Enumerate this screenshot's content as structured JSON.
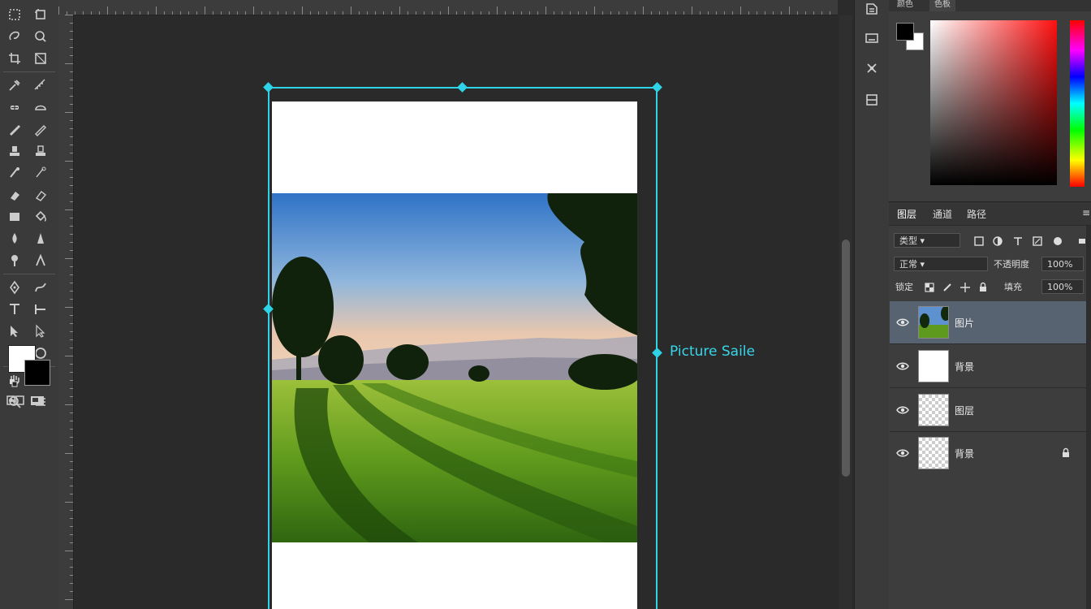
{
  "canvas": {
    "bbox_label": "Picture Saile"
  },
  "colors": {
    "accent": "#2fd3e8",
    "foreground": "#ffffff",
    "background": "#000000",
    "selected_layer": "#586372"
  },
  "tools": [
    "marquee-tool",
    "artboard-tool",
    "lasso-tool",
    "quick-selection-tool",
    "crop-tool",
    "frame-tool",
    "eyedropper-tool",
    "ruler-tool",
    "healing-brush-tool",
    "patch-tool",
    "brush-tool",
    "pencil-tool",
    "clone-stamp-tool",
    "pattern-stamp-tool",
    "history-brush-tool",
    "art-history-tool",
    "eraser-tool",
    "background-eraser-tool",
    "gradient-tool",
    "paint-bucket-tool",
    "blur-tool",
    "sharpen-tool",
    "dodge-tool",
    "burn-tool",
    "pen-tool",
    "freeform-pen-tool",
    "type-tool",
    "vertical-type-tool",
    "path-selection-tool",
    "direct-selection-tool",
    "rectangle-tool",
    "ellipse-tool",
    "hand-tool",
    "rotate-view-tool",
    "zoom-tool",
    "edit-toolbar-tool"
  ],
  "color_panel": {
    "tabs": [
      "颜色",
      "色板"
    ]
  },
  "layers_panel": {
    "tabs": [
      "图层",
      "通道",
      "路径"
    ],
    "filter_label": "类型",
    "blend_mode": "正常",
    "opacity_label": "不透明度",
    "opacity_value": "100%",
    "lock_label": "锁定",
    "fill_label": "填充",
    "fill_value": "100%",
    "layers": [
      {
        "name": "图片",
        "thumb": "photo",
        "selected": true
      },
      {
        "name": "背景",
        "thumb": "white",
        "selected": false
      },
      {
        "name": "图层",
        "thumb": "checker",
        "selected": false
      },
      {
        "name": "背景",
        "thumb": "checker",
        "selected": false,
        "locked": true
      }
    ]
  }
}
